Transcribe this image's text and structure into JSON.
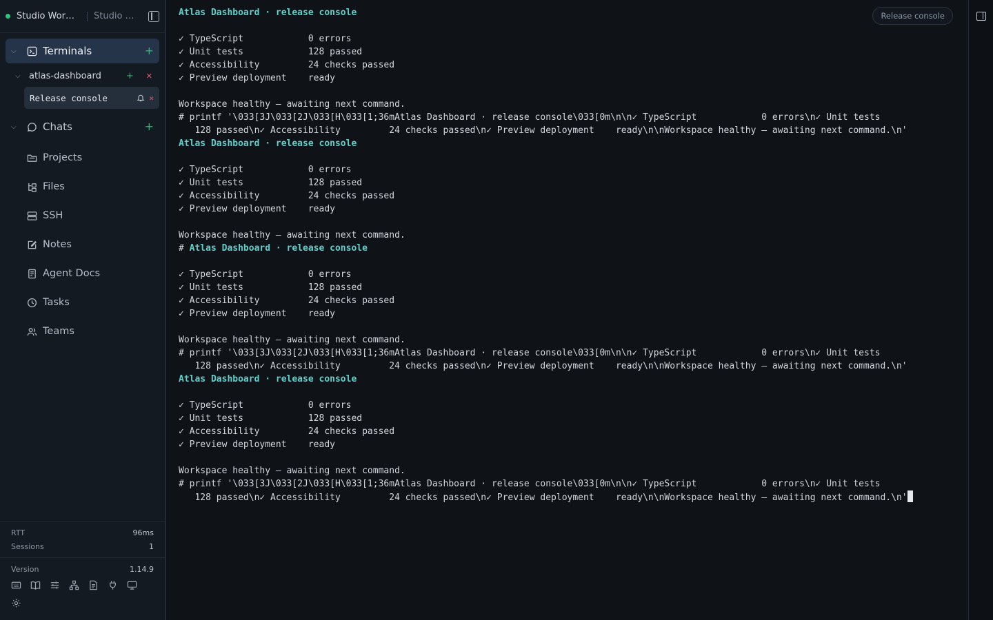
{
  "workspace": {
    "name": "Studio Work...",
    "secondary": "Studio S..."
  },
  "sidebar": {
    "terminals": {
      "label": "Terminals"
    },
    "project": {
      "label": "atlas-dashboard"
    },
    "terminal_item": {
      "label": "Release console"
    },
    "chats": {
      "label": "Chats"
    },
    "items": [
      {
        "label": "Projects",
        "icon": "folder-icon"
      },
      {
        "label": "Files",
        "icon": "file-tree-icon"
      },
      {
        "label": "SSH",
        "icon": "server-icon"
      },
      {
        "label": "Notes",
        "icon": "note-edit-icon"
      },
      {
        "label": "Agent Docs",
        "icon": "document-icon"
      },
      {
        "label": "Tasks",
        "icon": "clock-icon"
      },
      {
        "label": "Teams",
        "icon": "users-icon"
      }
    ]
  },
  "stats": {
    "rtt_label": "RTT",
    "rtt_value": "96ms",
    "sessions_label": "Sessions",
    "sessions_value": "1",
    "version_label": "Version",
    "version_value": "1.14.9"
  },
  "terminal": {
    "tab_label": "Release console",
    "lines": [
      {
        "text": "Atlas Dashboard · release console",
        "style": "hl"
      },
      {
        "text": ""
      },
      {
        "text": "✓ TypeScript            0 errors"
      },
      {
        "text": "✓ Unit tests            128 passed"
      },
      {
        "text": "✓ Accessibility         24 checks passed"
      },
      {
        "text": "✓ Preview deployment    ready"
      },
      {
        "text": ""
      },
      {
        "text": "Workspace healthy — awaiting next command."
      },
      {
        "text": "# printf '\\033[3J\\033[2J\\033[H\\033[1;36mAtlas Dashboard · release console\\033[0m\\n\\n✓ TypeScript            0 errors\\n✓ Unit tests"
      },
      {
        "text": "   128 passed\\n✓ Accessibility         24 checks passed\\n✓ Preview deployment    ready\\n\\nWorkspace healthy — awaiting next command.\\n'"
      },
      {
        "text": "Atlas Dashboard · release console",
        "style": "hl"
      },
      {
        "text": ""
      },
      {
        "text": "✓ TypeScript            0 errors"
      },
      {
        "text": "✓ Unit tests            128 passed"
      },
      {
        "text": "✓ Accessibility         24 checks passed"
      },
      {
        "text": "✓ Preview deployment    ready"
      },
      {
        "text": ""
      },
      {
        "text": "Workspace healthy — awaiting next command."
      },
      {
        "prefix": "# ",
        "text": "Atlas Dashboard · release console",
        "style": "hl"
      },
      {
        "text": ""
      },
      {
        "text": "✓ TypeScript            0 errors"
      },
      {
        "text": "✓ Unit tests            128 passed"
      },
      {
        "text": "✓ Accessibility         24 checks passed"
      },
      {
        "text": "✓ Preview deployment    ready"
      },
      {
        "text": ""
      },
      {
        "text": "Workspace healthy — awaiting next command."
      },
      {
        "text": "# printf '\\033[3J\\033[2J\\033[H\\033[1;36mAtlas Dashboard · release console\\033[0m\\n\\n✓ TypeScript            0 errors\\n✓ Unit tests"
      },
      {
        "text": "   128 passed\\n✓ Accessibility         24 checks passed\\n✓ Preview deployment    ready\\n\\nWorkspace healthy — awaiting next command.\\n'"
      },
      {
        "text": "Atlas Dashboard · release console",
        "style": "hl"
      },
      {
        "text": ""
      },
      {
        "text": "✓ TypeScript            0 errors"
      },
      {
        "text": "✓ Unit tests            128 passed"
      },
      {
        "text": "✓ Accessibility         24 checks passed"
      },
      {
        "text": "✓ Preview deployment    ready"
      },
      {
        "text": ""
      },
      {
        "text": "Workspace healthy — awaiting next command."
      },
      {
        "text": "# printf '\\033[3J\\033[2J\\033[H\\033[1;36mAtlas Dashboard · release console\\033[0m\\n\\n✓ TypeScript            0 errors\\n✓ Unit tests"
      },
      {
        "text": "   128 passed\\n✓ Accessibility         24 checks passed\\n✓ Preview deployment    ready\\n\\nWorkspace healthy — awaiting next command.\\n'",
        "cursor": true
      }
    ]
  },
  "colors": {
    "accent": "#2bb673",
    "highlight": "#5fd0c9",
    "danger": "#e35d6a",
    "active_bg": "#263449"
  }
}
